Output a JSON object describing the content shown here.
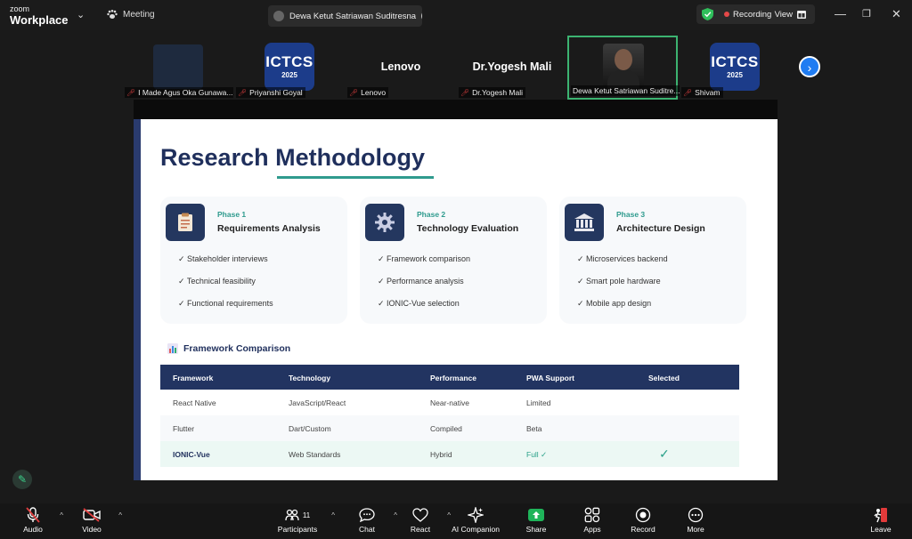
{
  "titlebar": {
    "brand_top": "zoom",
    "brand_bottom": "Workplace",
    "meeting_label": "Meeting",
    "share_tab_label": "Dewa Ketut Satriawan Suditresna",
    "recording_label": "Recording",
    "view_label": "View"
  },
  "participants": [
    {
      "name": "I Made Agus Oka Gunawa...",
      "display": "logo-dark"
    },
    {
      "name": "Priyanshi Goyal",
      "display": "ICTCS 2025"
    },
    {
      "name": "Lenovo",
      "display": "Lenovo"
    },
    {
      "name": "Dr.Yogesh Mali",
      "display": "Dr.Yogesh Mali"
    },
    {
      "name": "Dewa Ketut Satriawan Suditre...",
      "display": "video"
    },
    {
      "name": "Shivam",
      "display": "ICTCS 2025"
    }
  ],
  "logo": {
    "line1": "ICTCS",
    "line2": "2025"
  },
  "slide": {
    "title": "Research Methodology",
    "phases": [
      {
        "phase": "Phase 1",
        "title": "Requirements Analysis",
        "icon": "document-icon",
        "items": [
          "✓ Stakeholder interviews",
          "✓ Technical feasibility",
          "✓ Functional requirements"
        ]
      },
      {
        "phase": "Phase 2",
        "title": "Technology Evaluation",
        "icon": "gear-icon",
        "items": [
          "✓ Framework comparison",
          "✓ Performance analysis",
          "✓ IONIC-Vue selection"
        ]
      },
      {
        "phase": "Phase 3",
        "title": "Architecture Design",
        "icon": "building-icon",
        "items": [
          "✓ Microservices backend",
          "✓ Smart pole hardware",
          "✓ Mobile app design"
        ]
      }
    ],
    "comparison_title": "Framework Comparison",
    "table": {
      "headers": [
        "Framework",
        "Technology",
        "Performance",
        "PWA Support",
        "Selected"
      ],
      "rows": [
        [
          "React Native",
          "JavaScript/React",
          "Near-native",
          "Limited",
          ""
        ],
        [
          "Flutter",
          "Dart/Custom",
          "Compiled",
          "Beta",
          ""
        ],
        [
          "IONIC-Vue",
          "Web Standards",
          "Hybrid",
          "Full ✓",
          "✓"
        ]
      ]
    }
  },
  "toolbar": {
    "audio": "Audio",
    "video": "Video",
    "participants": "Participants",
    "participants_count": "11",
    "chat": "Chat",
    "react": "React",
    "ai": "AI Companion",
    "share": "Share",
    "apps": "Apps",
    "record": "Record",
    "more": "More",
    "leave": "Leave"
  }
}
